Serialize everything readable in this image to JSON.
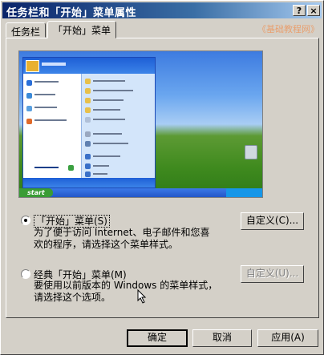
{
  "window": {
    "title": "任务栏和「开始」菜单属性",
    "help_button": "?",
    "close_button": "×",
    "watermark": "《基础教程网》"
  },
  "tabs": [
    {
      "label": "任务栏",
      "active": false
    },
    {
      "label": "「开始」菜单",
      "active": true
    }
  ],
  "preview": {
    "start_label": "start"
  },
  "options": [
    {
      "label": "「开始」菜单(S)",
      "selected": true,
      "description_line1": "为了便于访问 Internet、电子邮件和您喜",
      "description_line2": "欢的程序，请选择这个菜单样式。",
      "customize_label": "自定义(C)...",
      "customize_enabled": true
    },
    {
      "label": "经典「开始」菜单(M)",
      "selected": false,
      "description_line1": "要使用以前版本的 Windows 的菜单样式，",
      "description_line2": "请选择这个选项。",
      "customize_label": "自定义(U)...",
      "customize_enabled": false
    }
  ],
  "buttons": {
    "ok": "确定",
    "cancel": "取消",
    "apply": "应用(A)"
  },
  "colors": {
    "titlebar_start": "#0a246a",
    "titlebar_end": "#a6caf0",
    "face": "#d4d0c8"
  }
}
